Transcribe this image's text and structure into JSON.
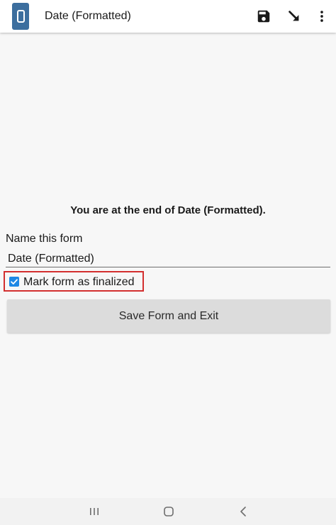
{
  "toolbar": {
    "title": "Date (Formatted)",
    "app_icon": "form-app-icon",
    "actions": [
      {
        "name": "save-icon"
      },
      {
        "name": "go-to-prompt-icon"
      },
      {
        "name": "more-vert-icon"
      }
    ]
  },
  "end_screen": {
    "message": "You are at the end of Date (Formatted).",
    "name_label": "Name this form",
    "name_value": "Date (Formatted)",
    "finalize_label": "Mark form as finalized",
    "finalize_checked": true,
    "save_button_label": "Save Form and Exit"
  },
  "navbar": {
    "buttons": [
      "recent-apps-icon",
      "home-icon",
      "back-icon"
    ]
  },
  "colors": {
    "app_icon": "#3c6e9e",
    "checkbox": "#1e88e5",
    "highlight_border": "#d32f2f",
    "button_bg": "#dcdcdc",
    "background": "#f7f7f7"
  }
}
